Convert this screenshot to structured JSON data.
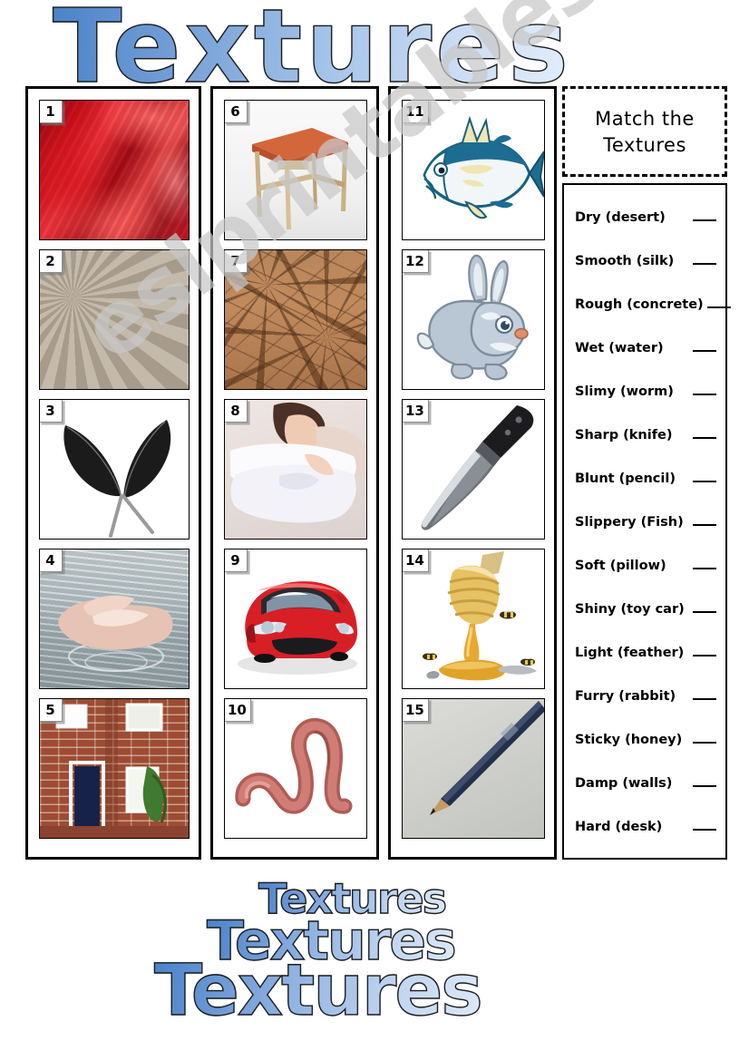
{
  "title": "Textures",
  "watermark": "eslprintables.com",
  "footer_titles": [
    "Textures",
    "Textures",
    "Textures"
  ],
  "panel": {
    "header_line1": "Match the",
    "header_line2": "Textures",
    "blank": "___"
  },
  "answers": [
    {
      "label": "Dry (desert)"
    },
    {
      "label": "Smooth (silk)"
    },
    {
      "label": "Rough (concrete)"
    },
    {
      "label": "Wet (water)"
    },
    {
      "label": "Slimy (worm)"
    },
    {
      "label": "Sharp (knife)"
    },
    {
      "label": "Blunt (pencil)"
    },
    {
      "label": "Slippery (Fish)"
    },
    {
      "label": "Soft (pillow)"
    },
    {
      "label": "Shiny (toy car)"
    },
    {
      "label": "Light (feather)"
    },
    {
      "label": "Furry (rabbit)"
    },
    {
      "label": "Sticky (honey)"
    },
    {
      "label": "Damp (walls)"
    },
    {
      "label": "Hard (desk)"
    }
  ],
  "columns": [
    {
      "items": [
        {
          "number": "1",
          "image": "red-silk-fabric"
        },
        {
          "number": "2",
          "image": "rough-concrete-texture"
        },
        {
          "number": "3",
          "image": "two-black-feathers"
        },
        {
          "number": "4",
          "image": "hands-cupping-water"
        },
        {
          "number": "5",
          "image": "red-brick-house-wall"
        }
      ]
    },
    {
      "items": [
        {
          "number": "6",
          "image": "wooden-desk-orange-top"
        },
        {
          "number": "7",
          "image": "cracked-dry-desert-earth"
        },
        {
          "number": "8",
          "image": "woman-sleeping-on-pillow"
        },
        {
          "number": "9",
          "image": "red-sports-car"
        },
        {
          "number": "10",
          "image": "earthworm"
        }
      ]
    },
    {
      "items": [
        {
          "number": "11",
          "image": "cartoon-tuna-fish"
        },
        {
          "number": "12",
          "image": "cartoon-grey-rabbit"
        },
        {
          "number": "13",
          "image": "kitchen-knife"
        },
        {
          "number": "14",
          "image": "honey-dipper-with-bees"
        },
        {
          "number": "15",
          "image": "dark-pencil"
        }
      ]
    }
  ],
  "colors": {
    "title_gradient_start": "#4a82c8",
    "title_gradient_end": "#e2eefb",
    "outline": "#1d1d1d",
    "border": "#000000",
    "watermark": "#c9c9c9"
  }
}
